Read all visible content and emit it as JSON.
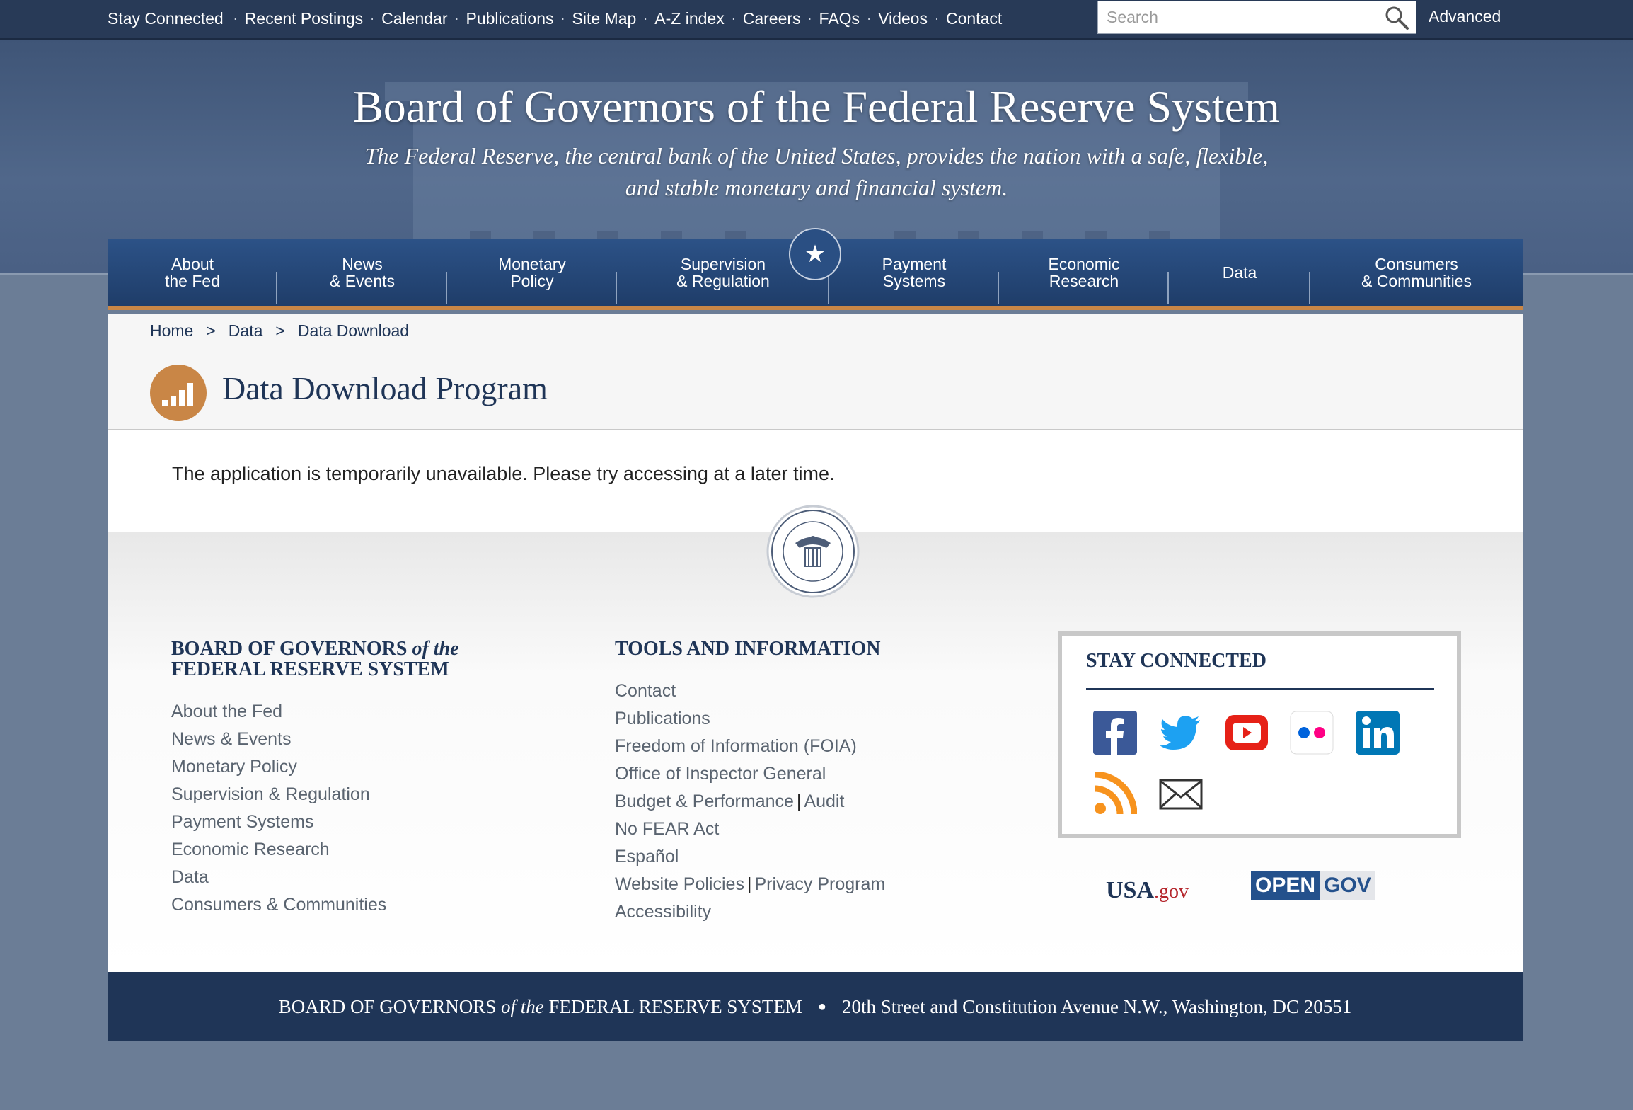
{
  "topnav": {
    "links": [
      "Stay Connected",
      "Recent Postings",
      "Calendar",
      "Publications",
      "Site Map",
      "A-Z index",
      "Careers",
      "FAQs",
      "Videos",
      "Contact"
    ],
    "search_placeholder": "Search",
    "advanced_label": "Advanced"
  },
  "header": {
    "title": "Board of Governors of the Federal Reserve System",
    "tagline": "The Federal Reserve, the central bank of the United States, provides the nation with a safe, flexible, and stable monetary and financial system."
  },
  "mainnav": {
    "items": [
      "About\nthe Fed",
      "News\n& Events",
      "Monetary\nPolicy",
      "Supervision\n& Regulation",
      "Payment\nSystems",
      "Economic\nResearch",
      "Data",
      "Consumers\n& Communities"
    ],
    "star": "★"
  },
  "breadcrumb": {
    "items": [
      "Home",
      "Data",
      "Data Download"
    ],
    "separator": ">"
  },
  "page": {
    "title": "Data Download Program",
    "message": "The application is temporarily unavailable. Please try accessing at a later time."
  },
  "footer": {
    "col1_heading_a": "BOARD OF GOVERNORS",
    "col1_heading_b": "of the",
    "col1_heading_c": "FEDERAL RESERVE SYSTEM",
    "col1_links": [
      "About the Fed",
      "News & Events",
      "Monetary Policy",
      "Supervision & Regulation",
      "Payment Systems",
      "Economic Research",
      "Data",
      "Consumers & Communities"
    ],
    "col2_heading": "TOOLS AND INFORMATION",
    "col2_links": {
      "contact": "Contact",
      "publications": "Publications",
      "foia": "Freedom of Information (FOIA)",
      "oig": "Office of Inspector General",
      "budget": "Budget & Performance",
      "audit": "Audit",
      "nofear": "No FEAR Act",
      "espanol": "Español",
      "policies": "Website Policies",
      "privacy": "Privacy Program",
      "accessibility": "Accessibility",
      "pipe": "|"
    },
    "stay_heading": "STAY CONNECTED",
    "social_icons": [
      "facebook-icon",
      "twitter-icon",
      "youtube-icon",
      "flickr-icon",
      "linkedin-icon",
      "rss-icon",
      "email-icon"
    ],
    "usagov_a": "USA",
    "usagov_b": ".gov",
    "opengov_a": "OPEN",
    "opengov_b": "GOV"
  },
  "bottombar": {
    "org_a": "BOARD OF GOVERNORS",
    "org_b": "of the",
    "org_c": "FEDERAL RESERVE SYSTEM",
    "bullet": "●",
    "address": "20th Street and Constitution Avenue N.W., Washington, DC 20551"
  },
  "colors": {
    "navy": "#1f3557",
    "accent_orange": "#c98646",
    "topbar": "#283a57",
    "page_bg": "#6b7d96"
  }
}
